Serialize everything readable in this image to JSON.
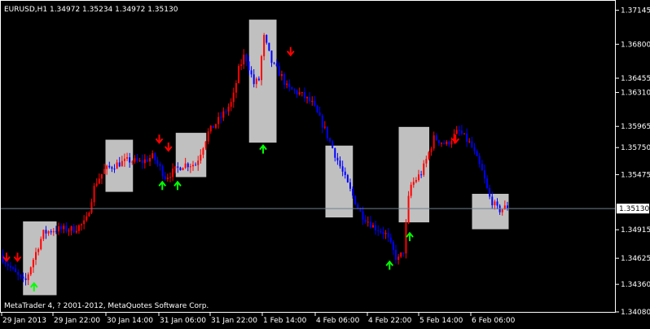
{
  "header": {
    "text": "EURUSD,H1  1.34972 1.35234 1.34972 1.35130"
  },
  "footer": {
    "text": "MetaTrader 4, ? 2001-2012, MetaQuotes Software Corp."
  },
  "price_label": "1.35130",
  "colors": {
    "background": "#000000",
    "bull": "#ff0000",
    "bear": "#0000ff",
    "box": "#c0c0c0",
    "arrow_up": "#00ff00",
    "arrow_down": "#ff0000",
    "axis": "#ffffff",
    "price_line": "#708090"
  },
  "chart_data": {
    "type": "candlestick",
    "symbol": "EURUSD",
    "timeframe": "H1",
    "last_bar": {
      "open": 1.34972,
      "high": 1.35234,
      "low": 1.34972,
      "close": 1.3513
    },
    "current_price": 1.3513,
    "ylim": [
      1.3408,
      1.372
    ],
    "y_ticks": [
      "1.37145",
      "1.36800",
      "1.36455",
      "1.36310",
      "1.35965",
      "1.35750",
      "1.35475",
      "1.35130",
      "1.34915",
      "1.34625",
      "1.34360",
      "1.34080"
    ],
    "x_labels": [
      "29 Jan 2013",
      "29 Jan 22:00",
      "30 Jan 14:00",
      "31 Jan 06:00",
      "31 Jan 22:00",
      "1 Feb 14:00",
      "4 Feb 06:00",
      "4 Feb 22:00",
      "5 Feb 14:00",
      "6 Feb 06:00"
    ],
    "price_path": [
      [
        0,
        1.3466
      ],
      [
        0.02,
        1.345
      ],
      [
        0.04,
        1.3437
      ],
      [
        0.05,
        1.3455
      ],
      [
        0.07,
        1.3488
      ],
      [
        0.09,
        1.3492
      ],
      [
        0.12,
        1.3492
      ],
      [
        0.14,
        1.3499
      ],
      [
        0.155,
        1.3538
      ],
      [
        0.17,
        1.3552
      ],
      [
        0.19,
        1.3558
      ],
      [
        0.21,
        1.3562
      ],
      [
        0.23,
        1.356
      ],
      [
        0.25,
        1.3566
      ],
      [
        0.27,
        1.3545
      ],
      [
        0.3,
        1.3558
      ],
      [
        0.32,
        1.3558
      ],
      [
        0.34,
        1.359
      ],
      [
        0.36,
        1.3605
      ],
      [
        0.38,
        1.3622
      ],
      [
        0.39,
        1.3654
      ],
      [
        0.4,
        1.367
      ],
      [
        0.415,
        1.364
      ],
      [
        0.425,
        1.3645
      ],
      [
        0.43,
        1.369
      ],
      [
        0.445,
        1.366
      ],
      [
        0.46,
        1.3648
      ],
      [
        0.47,
        1.3635
      ],
      [
        0.49,
        1.363
      ],
      [
        0.51,
        1.362
      ],
      [
        0.53,
        1.3595
      ],
      [
        0.55,
        1.3565
      ],
      [
        0.57,
        1.3535
      ],
      [
        0.59,
        1.3508
      ],
      [
        0.61,
        1.3495
      ],
      [
        0.63,
        1.3488
      ],
      [
        0.65,
        1.346
      ],
      [
        0.66,
        1.347
      ],
      [
        0.67,
        1.3535
      ],
      [
        0.69,
        1.355
      ],
      [
        0.71,
        1.3585
      ],
      [
        0.73,
        1.3578
      ],
      [
        0.75,
        1.3592
      ],
      [
        0.77,
        1.3578
      ],
      [
        0.79,
        1.3548
      ],
      [
        0.8,
        1.3525
      ],
      [
        0.815,
        1.3511
      ],
      [
        0.83,
        1.3515
      ]
    ],
    "boxes": [
      {
        "t0": 0.035,
        "t1": 0.09,
        "low": 1.3425,
        "high": 1.35
      },
      {
        "t0": 0.17,
        "t1": 0.215,
        "low": 1.353,
        "high": 1.3583
      },
      {
        "t0": 0.285,
        "t1": 0.335,
        "low": 1.3545,
        "high": 1.359
      },
      {
        "t0": 0.405,
        "t1": 0.45,
        "low": 1.358,
        "high": 1.3705
      },
      {
        "t0": 0.53,
        "t1": 0.575,
        "low": 1.3504,
        "high": 1.3577
      },
      {
        "t0": 0.65,
        "t1": 0.7,
        "low": 1.3499,
        "high": 1.3596
      },
      {
        "t0": 0.77,
        "t1": 0.83,
        "low": 1.3492,
        "high": 1.3528
      }
    ],
    "arrows": [
      {
        "t": 0.0,
        "value": 1.3464,
        "dir": "down"
      },
      {
        "t": 0.018,
        "value": 1.3464,
        "dir": "down"
      },
      {
        "t": 0.045,
        "value": 1.3433,
        "dir": "up"
      },
      {
        "t": 0.25,
        "value": 1.3584,
        "dir": "down"
      },
      {
        "t": 0.265,
        "value": 1.3576,
        "dir": "down"
      },
      {
        "t": 0.255,
        "value": 1.3536,
        "dir": "up"
      },
      {
        "t": 0.28,
        "value": 1.3536,
        "dir": "up"
      },
      {
        "t": 0.465,
        "value": 1.3673,
        "dir": "down"
      },
      {
        "t": 0.42,
        "value": 1.3573,
        "dir": "up"
      },
      {
        "t": 0.627,
        "value": 1.3455,
        "dir": "up"
      },
      {
        "t": 0.66,
        "value": 1.3484,
        "dir": "up"
      },
      {
        "t": 0.735,
        "value": 1.3584,
        "dir": "down"
      }
    ]
  }
}
